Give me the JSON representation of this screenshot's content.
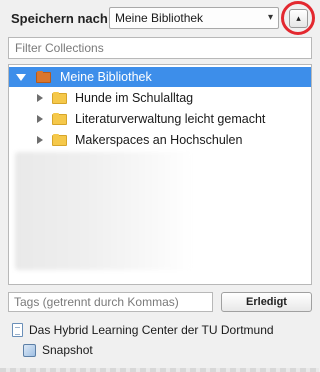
{
  "header": {
    "save_label": "Speichern nach",
    "library_select_value": "Meine Bibliothek",
    "library_select_chevron": "▾",
    "collapse_button_glyph": "▴"
  },
  "filter": {
    "placeholder": "Filter Collections",
    "value": ""
  },
  "tree": {
    "root": {
      "label": "Meine Bibliothek",
      "expanded": true,
      "selected": true
    },
    "children": [
      {
        "label": "Hunde im Schulalltag"
      },
      {
        "label": "Literaturverwaltung leicht gemacht"
      },
      {
        "label": "Makerspaces an Hochschulen"
      }
    ]
  },
  "tags": {
    "placeholder": "Tags (getrennt durch Kommas)",
    "value": "",
    "done_label": "Erledigt"
  },
  "items": {
    "document_title": "Das Hybrid Learning Center der TU Dortmund",
    "attachment_label": "Snapshot"
  },
  "colors": {
    "selection": "#3d8eea",
    "highlight_ring": "#e3282f",
    "library_icon": "#d9762e",
    "collection_icon": "#f5c84a"
  }
}
